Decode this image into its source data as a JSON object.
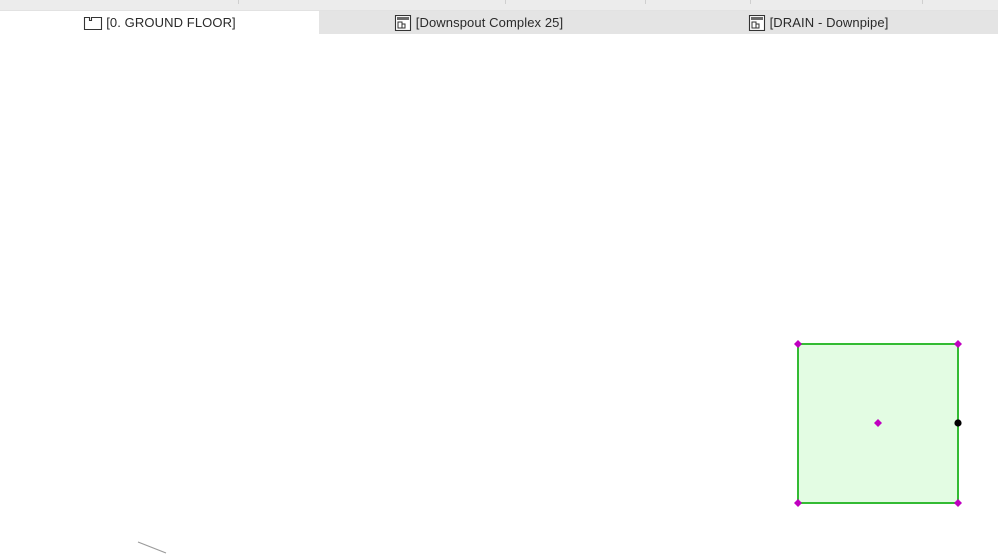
{
  "tabs": [
    {
      "label": "[0. GROUND FLOOR]",
      "icon": "floor-plan-icon",
      "active": true
    },
    {
      "label": "[Downspout Complex 25]",
      "icon": "detail-view-icon",
      "active": false
    },
    {
      "label": "[DRAIN - Downpipe]",
      "icon": "detail-view-icon",
      "active": false
    }
  ],
  "colors": {
    "tab_bar": "#e4e4e4",
    "active_tab": "#ffffff",
    "shape_fill": "#e3fce3",
    "shape_stroke": "#33bb33",
    "handle": "#c000c0",
    "edge_handle": "#000000",
    "stray_line": "#9a9a9a"
  },
  "canvas": {
    "selected_element": {
      "type": "rectangle",
      "selected": true,
      "handles": [
        "corner",
        "corner",
        "corner",
        "corner",
        "center",
        "edge-midpoint"
      ]
    }
  }
}
